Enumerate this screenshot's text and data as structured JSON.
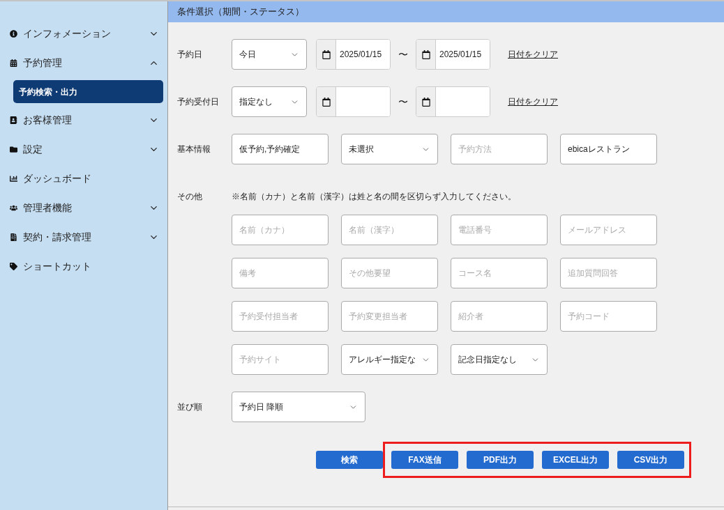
{
  "sidebar": {
    "items": [
      {
        "label": "インフォメーション",
        "kind": "group",
        "expanded": false
      },
      {
        "label": "予約管理",
        "kind": "group",
        "expanded": true,
        "children": [
          {
            "label": "予約検索・出力",
            "selected": true
          }
        ]
      },
      {
        "label": "お客様管理",
        "kind": "group",
        "expanded": false
      },
      {
        "label": "設定",
        "kind": "group",
        "expanded": false
      },
      {
        "label": "ダッシュボード",
        "kind": "link"
      },
      {
        "label": "管理者機能",
        "kind": "group",
        "expanded": false
      },
      {
        "label": "契約・請求管理",
        "kind": "group",
        "expanded": false
      },
      {
        "label": "ショートカット",
        "kind": "link"
      }
    ]
  },
  "panel": {
    "title": "条件選択（期間・ステータス）",
    "rows": [
      {
        "kind": "date_range",
        "label": "予約日",
        "preset": "今日",
        "from": "2025/01/15",
        "separator": "〜",
        "to": "2025/01/15",
        "clear_link": "日付をクリア"
      },
      {
        "kind": "date_range",
        "label": "予約受付日",
        "preset": "指定なし",
        "separator": "〜",
        "clear_link": "日付をクリア"
      },
      {
        "kind": "fields",
        "label": "基本情報",
        "fields": [
          {
            "kind": "text",
            "value": "仮予約,予約確定"
          },
          {
            "kind": "select",
            "value": "未選択"
          },
          {
            "kind": "text",
            "placeholder": "予約方法"
          },
          {
            "kind": "text",
            "value": "ebicaレストラン"
          }
        ]
      },
      {
        "kind": "fields",
        "label": "その他",
        "note": "※名前（カナ）と名前（漢字）は姓と名の間を区切らず入力してください。",
        "fields": [
          {
            "kind": "text",
            "placeholder": "名前（カナ）"
          },
          {
            "kind": "text",
            "placeholder": "名前（漢字）"
          },
          {
            "kind": "text",
            "placeholder": "電話番号"
          },
          {
            "kind": "text",
            "placeholder": "メールアドレス"
          },
          {
            "kind": "text",
            "placeholder": "備考"
          },
          {
            "kind": "text",
            "placeholder": "その他要望"
          },
          {
            "kind": "text",
            "placeholder": "コース名"
          },
          {
            "kind": "text",
            "placeholder": "追加質問回答"
          },
          {
            "kind": "text",
            "placeholder": "予約受付担当者"
          },
          {
            "kind": "text",
            "placeholder": "予約変更担当者"
          },
          {
            "kind": "text",
            "placeholder": "紹介者"
          },
          {
            "kind": "text",
            "placeholder": "予約コード"
          },
          {
            "kind": "text",
            "placeholder": "予約サイト"
          },
          {
            "kind": "select",
            "value": "アレルギー指定な"
          },
          {
            "kind": "select",
            "value": "記念日指定なし"
          }
        ]
      },
      {
        "kind": "sort",
        "label": "並び順",
        "value": "予約日 降順"
      }
    ]
  },
  "actions": {
    "search": "検索",
    "export_group": {
      "highlighted": true,
      "buttons": [
        "FAX送信",
        "PDF出力",
        "EXCEL出力",
        "CSV出力"
      ]
    }
  }
}
